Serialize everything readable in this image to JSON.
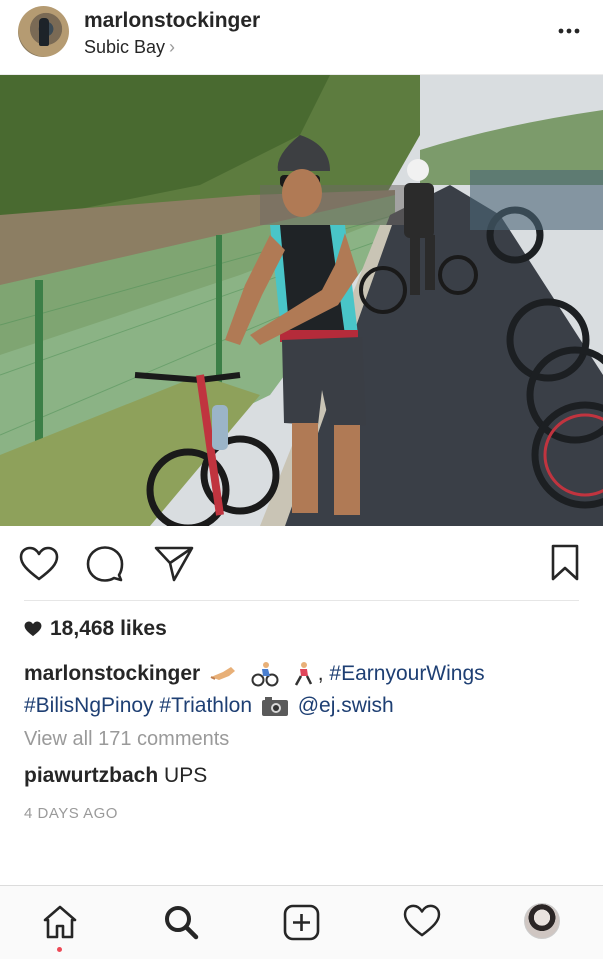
{
  "post": {
    "username": "marlonstockinger",
    "location": "Subic Bay",
    "location_chevron": "›",
    "photo_alt": "",
    "likes": "18,468 likes",
    "caption": {
      "username": "marlonstockinger",
      "hashtag1": "#EarnyourWings",
      "hashtag2": "#BilisNgPinoy",
      "hashtag3": "#Triathlon",
      "mention": "@ej.swish",
      "emojis": [
        "flexed-biceps-emoji",
        "cyclist-emoji",
        "runner-emoji",
        "camera-emoji"
      ]
    },
    "view_comments": "View all 171 comments",
    "comment": {
      "username": "piawurtzbach",
      "text": "UPS"
    },
    "timestamp": "4 DAYS AGO"
  },
  "colors": {
    "text": "#262626",
    "muted": "#9a9a9a",
    "hashtag": "#1e3f73",
    "notification_dot": "#ed4956"
  },
  "icons": {
    "header": [
      "more-options-icon"
    ],
    "actions": [
      "heart-icon",
      "comment-icon",
      "share-icon",
      "bookmark-icon"
    ],
    "likes": [
      "heart-filled-icon"
    ],
    "nav": [
      "home-icon",
      "search-icon",
      "add-post-icon",
      "activity-heart-icon",
      "profile-avatar"
    ]
  }
}
